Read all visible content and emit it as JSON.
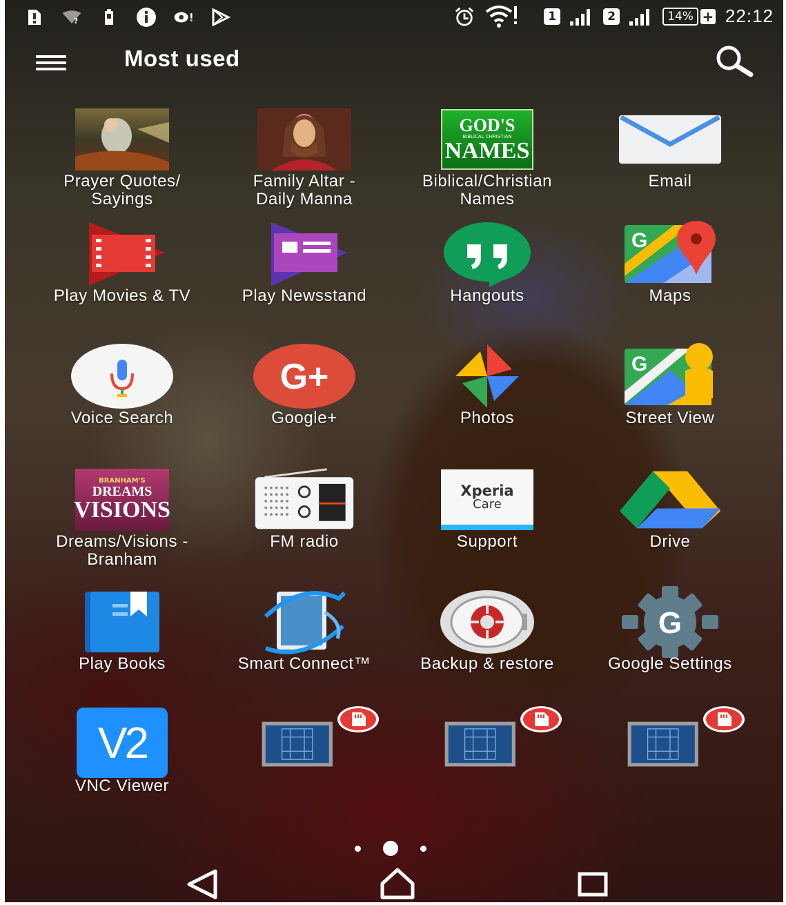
{
  "status_bar": {
    "left_icons": [
      "sim-alert-icon",
      "wifi-question-icon",
      "battery-saver-icon",
      "info-icon",
      "record-icon",
      "play-store-icon"
    ],
    "sim1_label": "1",
    "sim2_label": "2",
    "battery_percent": "14%",
    "time": "22:12"
  },
  "header": {
    "title": "Most used"
  },
  "apps": [
    {
      "label": "Prayer Quotes/\nSayings"
    },
    {
      "label": "Family Altar -\nDaily Manna"
    },
    {
      "label": "Biblical/Christian\nNames",
      "icon_text_1": "GOD'S",
      "icon_text_2": "BIBLICAL CHRISTIAN",
      "icon_text_3": "NAMES"
    },
    {
      "label": "Email"
    },
    {
      "label": "Play Movies & TV"
    },
    {
      "label": "Play Newsstand"
    },
    {
      "label": "Hangouts"
    },
    {
      "label": "Maps",
      "icon_text": "G"
    },
    {
      "label": "Voice Search"
    },
    {
      "label": "Google+",
      "icon_text": "G+"
    },
    {
      "label": "Photos"
    },
    {
      "label": "Street View",
      "icon_text": "G"
    },
    {
      "label": "Dreams/Visions -\nBranham",
      "icon_text_1": "BRANHAM'S",
      "icon_text_2": "DREAMS",
      "icon_text_3": "VISIONS"
    },
    {
      "label": "FM radio"
    },
    {
      "label": "Support",
      "icon_text_1": "Xperia",
      "icon_text_2": "Care"
    },
    {
      "label": "Drive"
    },
    {
      "label": "Play Books"
    },
    {
      "label": "Smart Connect™"
    },
    {
      "label": "Backup & restore"
    },
    {
      "label": "Google Settings",
      "icon_text": "G"
    },
    {
      "label": "VNC Viewer",
      "icon_text": "V2"
    },
    {
      "label": ""
    },
    {
      "label": ""
    },
    {
      "label": ""
    }
  ],
  "colors": {
    "gmail_blue": "#4a90e2",
    "hangouts_green": "#0f9d58",
    "gplus_red": "#dd4b39",
    "drive_yellow": "#fbbc04",
    "books_blue": "#1e88e5",
    "vnc_blue": "#1e90ff",
    "sd_badge_red": "#e53935"
  },
  "page_indicator": {
    "count": 3,
    "active": 1
  }
}
